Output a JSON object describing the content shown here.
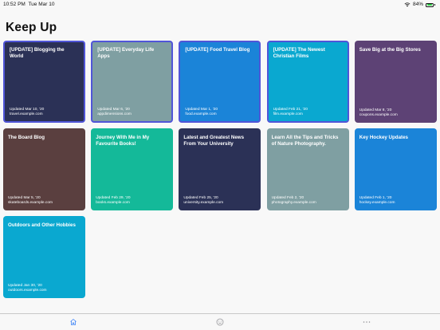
{
  "status": {
    "time": "10:52 PM",
    "date": "Tue Mar 10",
    "battery": "84%",
    "battery_level": 0.84
  },
  "page": {
    "title": "Keep Up"
  },
  "cards": [
    {
      "title": "[UPDATE] Blogging the World",
      "updated": "Updated Mar 10, '20",
      "domain": "travel.example.com",
      "color": "#2b3156",
      "selected": true
    },
    {
      "title": "[UPDATE] Everyday Life Apps",
      "updated": "Updated Mar 6, '20",
      "domain": "appdimensions.com",
      "color": "#7f9fa2",
      "selected": true
    },
    {
      "title": "[UPDATE] Food Travel Blog",
      "updated": "Updated Mar 1, '20",
      "domain": "food.example.com",
      "color": "#1b84d8",
      "selected": true
    },
    {
      "title": "[UPDATE] The Newest Christian Films",
      "updated": "Updated Feb 21, '20",
      "domain": "film.example.com",
      "color": "#0aa8d0",
      "selected": true
    },
    {
      "title": "Save Big at the Big Stores",
      "updated": "Updated Mar 8, '20",
      "domain": "coupons.example.com",
      "color": "#5d4275",
      "selected": false
    },
    {
      "title": "The Board Blog",
      "updated": "Updated Mar 5, '20",
      "domain": "skateboards.example.com",
      "color": "#5a3f3f",
      "selected": false
    },
    {
      "title": "Journey With Me in My Favourite Books!",
      "updated": "Updated Feb 29, '20",
      "domain": "books.example.com",
      "color": "#14b999",
      "selected": false
    },
    {
      "title": "Latest and Greatest News From Your University",
      "updated": "Updated Feb 25, '20",
      "domain": "university.example.com",
      "color": "#2b3156",
      "selected": false
    },
    {
      "title": "Learn All the Tips and Tricks of Nature Photography.",
      "updated": "Updated Feb 2, '20",
      "domain": "photography.example.com",
      "color": "#7f9fa2",
      "selected": false
    },
    {
      "title": "Key Hockey Updates",
      "updated": "Updated Feb 1, '20",
      "domain": "hockey.example.com",
      "color": "#1b84d8",
      "selected": false
    },
    {
      "title": "Outdoors and Other Hobbies",
      "updated": "Updated Jan 30, '20",
      "domain": "outdoors.example.com",
      "color": "#0aa8d0",
      "selected": false
    }
  ],
  "tabs": [
    {
      "name": "home-icon",
      "color": "#3b82f6"
    },
    {
      "name": "smiley-icon",
      "color": "#8e8e93"
    },
    {
      "name": "ellipsis-icon",
      "color": "#8e8e93"
    }
  ]
}
